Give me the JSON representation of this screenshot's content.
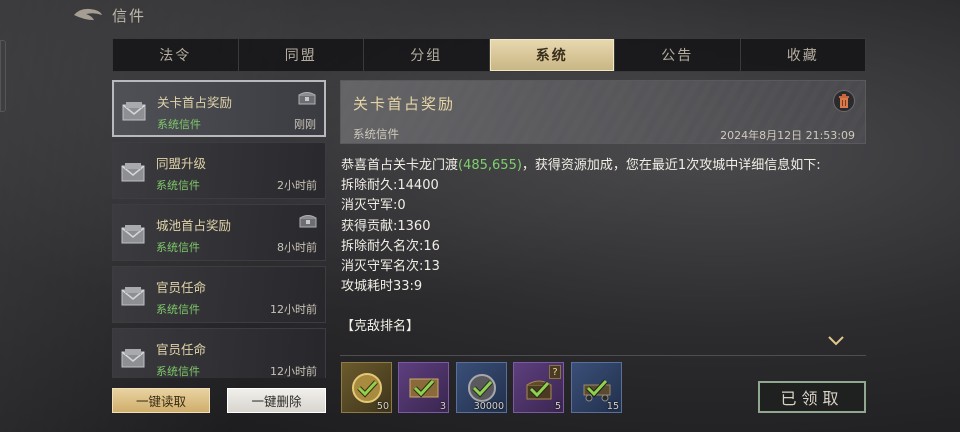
{
  "header": {
    "title": "信件",
    "back_icon": "back-arrow-icon"
  },
  "tabs": [
    {
      "label": "法令",
      "active": false
    },
    {
      "label": "同盟",
      "active": false
    },
    {
      "label": "分组",
      "active": false
    },
    {
      "label": "系统",
      "active": true
    },
    {
      "label": "公告",
      "active": false
    },
    {
      "label": "收藏",
      "active": false
    }
  ],
  "mail_list": [
    {
      "subject": "关卡首占奖励",
      "type": "系统信件",
      "time": "刚刚",
      "has_reward": true,
      "selected": true
    },
    {
      "subject": "同盟升级",
      "type": "系统信件",
      "time": "2小时前",
      "has_reward": false,
      "selected": false
    },
    {
      "subject": "城池首占奖励",
      "type": "系统信件",
      "time": "8小时前",
      "has_reward": true,
      "selected": false
    },
    {
      "subject": "官员任命",
      "type": "系统信件",
      "time": "12小时前",
      "has_reward": false,
      "selected": false
    },
    {
      "subject": "官员任命",
      "type": "系统信件",
      "time": "12小时前",
      "has_reward": false,
      "selected": false
    }
  ],
  "buttons": {
    "read_all": "一键读取",
    "delete_all": "一键删除",
    "claimed": "已领取"
  },
  "detail": {
    "title": "关卡首占奖励",
    "type": "系统信件",
    "date": "2024年8月12日 21:53:09",
    "body_prefix": "恭喜首占关卡龙门渡",
    "coords": "(485,655)",
    "body_suffix": "，获得资源加成，您在最近1次攻城中详细信息如下:",
    "lines": [
      "拆除耐久:14400",
      "消灭守军:0",
      "获得贡献:1360",
      "拆除耐久名次:16",
      "消灭守军名次:13",
      "攻城耗时33:9"
    ],
    "ranking_label": "【克敌排名】"
  },
  "rewards": [
    {
      "count": "50",
      "quality": "gold",
      "icon": "coin-check-icon"
    },
    {
      "count": "3",
      "quality": "purple",
      "icon": "scroll-check-icon"
    },
    {
      "count": "30000",
      "quality": "blue",
      "icon": "coin-check-icon"
    },
    {
      "count": "5",
      "quality": "purple",
      "icon": "chest-check-icon",
      "unknown": "?"
    },
    {
      "count": "15",
      "quality": "blue",
      "icon": "cart-check-icon"
    }
  ],
  "colors": {
    "accent_gold": "#e6d6a6",
    "type_green": "#7fc86a",
    "coords_green": "#7fd06e",
    "tab_active": "#c9b584"
  }
}
